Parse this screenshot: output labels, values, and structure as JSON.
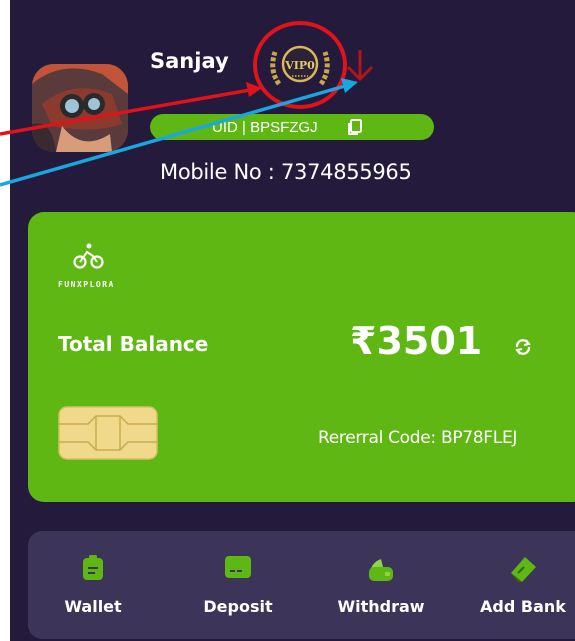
{
  "profile": {
    "name": "Sanjay",
    "vip_badge_text": "VIP0",
    "uid_text": "UID | BPSFZGJ",
    "mobile_text": "Mobile No : 7374855965"
  },
  "card": {
    "brand_name": "FUNXPLORA",
    "balance_label": "Total Balance",
    "balance_amount": "₹3501",
    "referral_text": "Rererral Code: BP78FLEJ"
  },
  "actions": [
    {
      "label": "Wallet",
      "icon": "wallet-icon"
    },
    {
      "label": "Deposit",
      "icon": "deposit-card-icon"
    },
    {
      "label": "Withdraw",
      "icon": "withdraw-icon"
    },
    {
      "label": "Add Bank",
      "icon": "add-bank-icon"
    }
  ],
  "colors": {
    "background": "#231a3c",
    "accent_green": "#5fb713",
    "action_bar": "#3d3459",
    "annotation_red": "#e0121a",
    "annotation_blue": "#1aa6df"
  }
}
